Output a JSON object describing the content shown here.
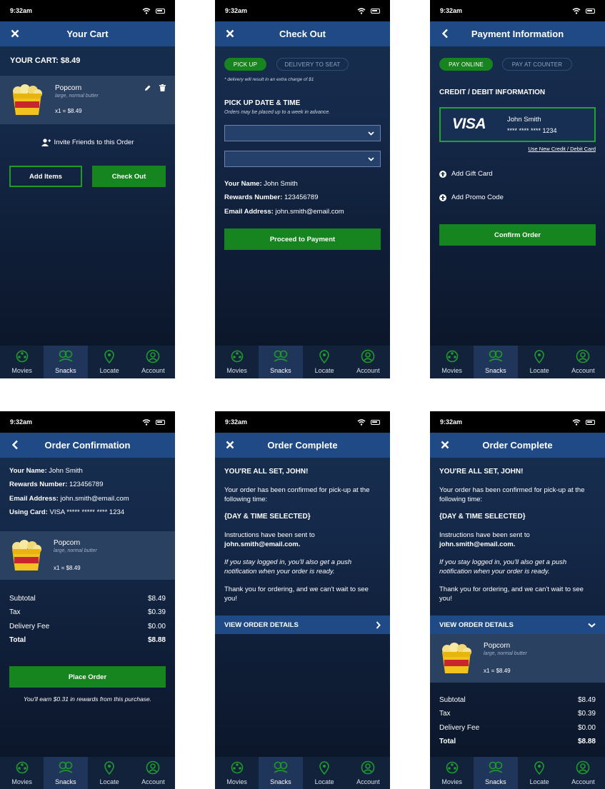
{
  "status": {
    "time": "9:32am"
  },
  "tabs": [
    "Movies",
    "Snacks",
    "Locate",
    "Account"
  ],
  "colors": {
    "accent_green": "#17851f",
    "header_blue": "#1f4a85",
    "background_navy": "#15294a"
  },
  "item": {
    "name": "Popcorn",
    "desc": "large, normal butter",
    "qty": "x1 = $8.49",
    "image": "popcorn-bucket"
  },
  "user": {
    "name_label": "Your Name:",
    "name": "John Smith",
    "rewards_label": "Rewards Number:",
    "rewards": "123456789",
    "email_label": "Email Address:",
    "email": "john.smith@email.com",
    "card_label": "Using Card:",
    "card": "VISA ***** ***** **** 1234"
  },
  "totals": [
    {
      "label": "Subtotal",
      "value": "$8.49"
    },
    {
      "label": "Tax",
      "value": "$0.39"
    },
    {
      "label": "Delivery Fee",
      "value": "$0.00"
    },
    {
      "label": "Total",
      "value": "$8.88"
    }
  ],
  "cart": {
    "title": "Your Cart",
    "total": "YOUR CART: $8.49",
    "invite": "Invite Friends to this Order",
    "add_items": "Add Items",
    "checkout": "Check Out"
  },
  "checkout": {
    "title": "Check Out",
    "pickup": "PICK UP",
    "delivery": "DELIVERY TO SEAT",
    "note": "* delivery will result in an extra charge of $1",
    "section": "PICK UP DATE & TIME",
    "section_note": "Orders may be placed up to a week in advance.",
    "proceed": "Proceed to Payment"
  },
  "payment": {
    "title": "Payment Information",
    "pay_online": "PAY ONLINE",
    "pay_counter": "PAY AT COUNTER",
    "section": "CREDIT / DEBIT INFORMATION",
    "card_brand": "VISA",
    "card_name": "John Smith",
    "card_number": "**** **** **** 1234",
    "new_card": "Use New Credit / Debit Card",
    "gift": "Add Gift Card",
    "promo": "Add Promo Code",
    "confirm": "Confirm Order"
  },
  "confirmation": {
    "title": "Order Confirmation",
    "place": "Place Order",
    "rewards_note": "You'll earn $0.31 in rewards from this purchase."
  },
  "complete": {
    "title": "Order Complete",
    "heading": "YOU'RE ALL SET, JOHN!",
    "p1": "Your order has been confirmed for pick-up at the following time:",
    "time_placeholder": "{DAY & TIME SELECTED}",
    "p2": "Instructions have been sent to",
    "email": "john.smith@email.com.",
    "p3": "If you stay logged in, you'll also get a push notification when your order is ready.",
    "p4": "Thank you for ordering, and we can't wait to see you!",
    "view_details": "VIEW ORDER DETAILS"
  }
}
